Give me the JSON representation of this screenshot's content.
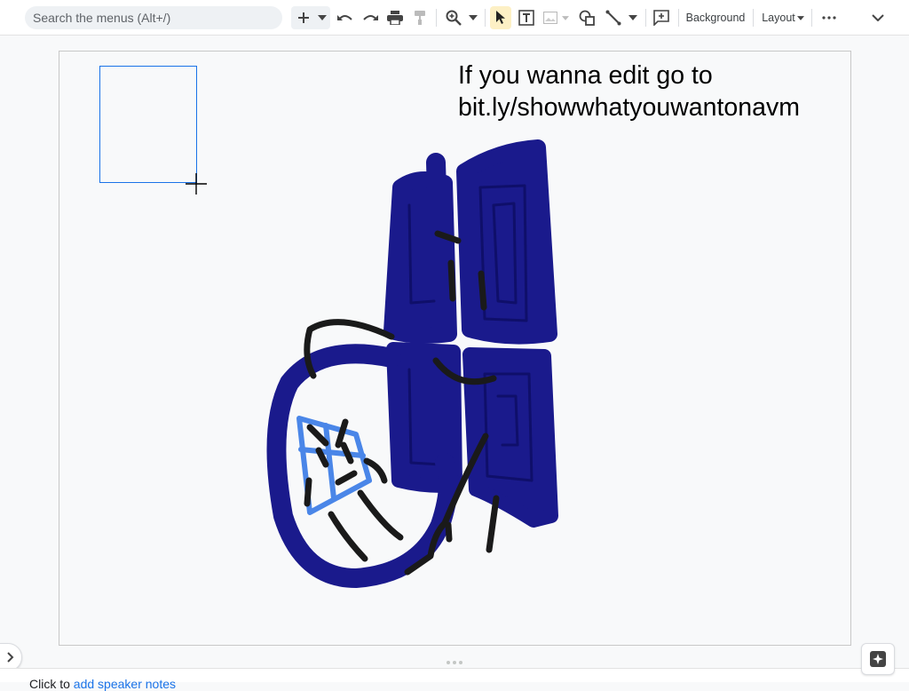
{
  "toolbar": {
    "search_placeholder": "Search the menus (Alt+/)",
    "background_label": "Background",
    "layout_label": "Layout",
    "icons": [
      "plus-icon",
      "dropdown-icon",
      "undo-icon",
      "redo-icon",
      "print-icon",
      "paint-format-icon",
      "zoom-icon",
      "select-icon",
      "text-box-icon",
      "image-icon",
      "shape-icon",
      "line-icon",
      "comment-icon",
      "more-icon",
      "collapse-icon"
    ]
  },
  "slide": {
    "text_line1": "If you wanna edit go to",
    "text_line2": "bit.ly/showwhatyouwantonavm",
    "drawing_colors": {
      "dark_blue": "#1a1a8c",
      "light_blue": "#4a86e8",
      "black": "#1a1a1a"
    }
  },
  "notes": {
    "prefix": "Click to ",
    "link": "add speaker notes",
    "text": "Click to add speaker notes"
  }
}
